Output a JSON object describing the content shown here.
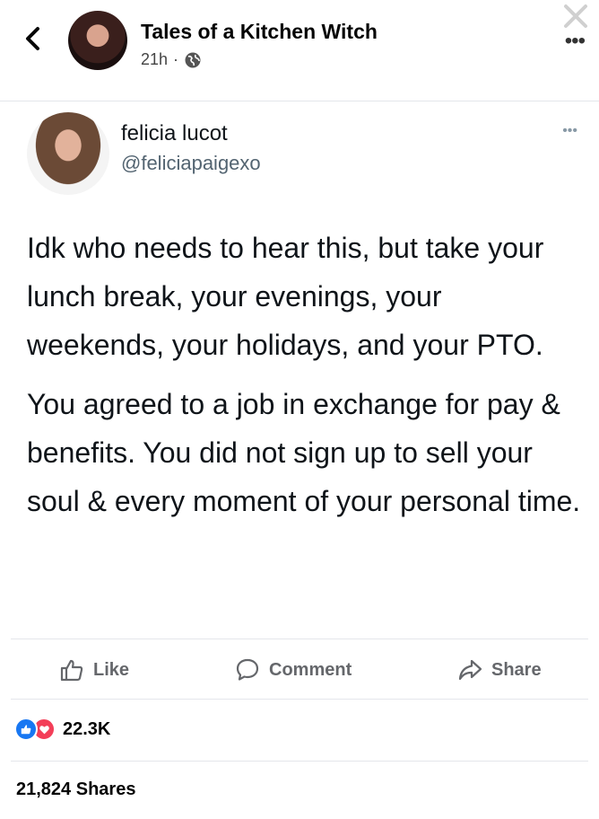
{
  "header": {
    "page_name": "Tales of a Kitchen Witch",
    "time": "21h",
    "separator": "·",
    "more": "•••"
  },
  "tweet": {
    "name": "felicia lucot",
    "handle": "@feliciapaigexo",
    "more": "•••",
    "paragraph1": "Idk who needs to hear this, but take your lunch break, your evenings, your weekends, your holidays, and your PTO.",
    "paragraph2": "You agreed to a job in exchange for pay & benefits. You did not sign up to sell your soul & every moment of your personal time."
  },
  "actions": {
    "like": "Like",
    "comment": "Comment",
    "share": "Share"
  },
  "stats": {
    "reactions": "22.3K",
    "shares": "21,824 Shares"
  },
  "colors": {
    "like_blue": "#1877f2",
    "love_red": "#f33e58",
    "muted_text": "#65676b"
  },
  "icons": [
    "back-chevron-icon",
    "globe-icon",
    "close-icon",
    "thumbs-up-icon",
    "comment-bubble-icon",
    "share-arrow-icon",
    "like-reaction-icon",
    "love-reaction-icon"
  ]
}
